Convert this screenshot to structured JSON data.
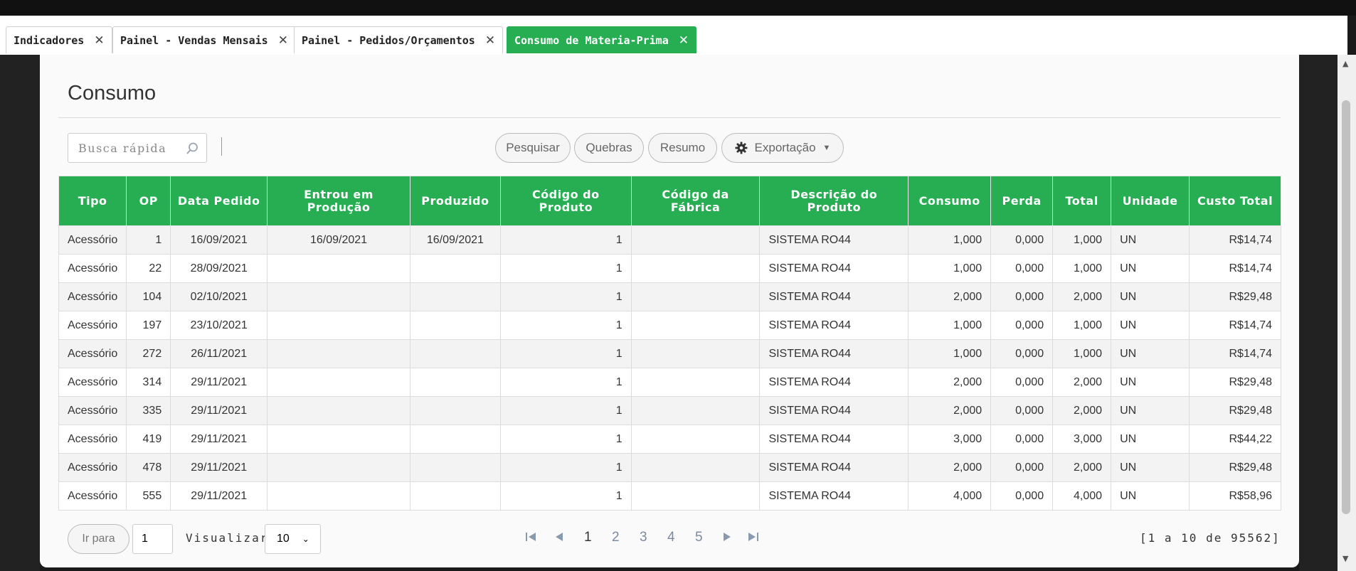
{
  "tabs": [
    {
      "label": "Indicadores",
      "active": false
    },
    {
      "label": "Painel - Vendas Mensais",
      "active": false
    },
    {
      "label": "Painel - Pedidos/Orçamentos",
      "active": false
    },
    {
      "label": "Consumo de Materia-Prima",
      "active": true
    }
  ],
  "page": {
    "title": "Consumo"
  },
  "search": {
    "placeholder": "Busca rápida"
  },
  "toolbar": {
    "pesquisar": "Pesquisar",
    "quebras": "Quebras",
    "resumo": "Resumo",
    "exportacao": "Exportação"
  },
  "table": {
    "headers": {
      "tipo": "Tipo",
      "op": "OP",
      "data_pedido": "Data Pedido",
      "entrou": "Entrou em Produção",
      "produzido": "Produzido",
      "cod_produto": "Código do Produto",
      "cod_fabrica": "Código da Fábrica",
      "descricao": "Descrição do Produto",
      "consumo": "Consumo",
      "perda": "Perda",
      "total": "Total",
      "unidade": "Unidade",
      "custo": "Custo Total"
    },
    "rows": [
      {
        "tipo": "Acessório",
        "op": "1",
        "data": "16/09/2021",
        "entrou": "16/09/2021",
        "produzido": "16/09/2021",
        "cod_produto": "1",
        "cod_fabrica": "",
        "descricao": "SISTEMA RO44",
        "consumo": "1,000",
        "perda": "0,000",
        "total": "1,000",
        "unidade": "UN",
        "custo": "R$14,74"
      },
      {
        "tipo": "Acessório",
        "op": "22",
        "data": "28/09/2021",
        "entrou": "",
        "produzido": "",
        "cod_produto": "1",
        "cod_fabrica": "",
        "descricao": "SISTEMA RO44",
        "consumo": "1,000",
        "perda": "0,000",
        "total": "1,000",
        "unidade": "UN",
        "custo": "R$14,74"
      },
      {
        "tipo": "Acessório",
        "op": "104",
        "data": "02/10/2021",
        "entrou": "",
        "produzido": "",
        "cod_produto": "1",
        "cod_fabrica": "",
        "descricao": "SISTEMA RO44",
        "consumo": "2,000",
        "perda": "0,000",
        "total": "2,000",
        "unidade": "UN",
        "custo": "R$29,48"
      },
      {
        "tipo": "Acessório",
        "op": "197",
        "data": "23/10/2021",
        "entrou": "",
        "produzido": "",
        "cod_produto": "1",
        "cod_fabrica": "",
        "descricao": "SISTEMA RO44",
        "consumo": "1,000",
        "perda": "0,000",
        "total": "1,000",
        "unidade": "UN",
        "custo": "R$14,74"
      },
      {
        "tipo": "Acessório",
        "op": "272",
        "data": "26/11/2021",
        "entrou": "",
        "produzido": "",
        "cod_produto": "1",
        "cod_fabrica": "",
        "descricao": "SISTEMA RO44",
        "consumo": "1,000",
        "perda": "0,000",
        "total": "1,000",
        "unidade": "UN",
        "custo": "R$14,74"
      },
      {
        "tipo": "Acessório",
        "op": "314",
        "data": "29/11/2021",
        "entrou": "",
        "produzido": "",
        "cod_produto": "1",
        "cod_fabrica": "",
        "descricao": "SISTEMA RO44",
        "consumo": "2,000",
        "perda": "0,000",
        "total": "2,000",
        "unidade": "UN",
        "custo": "R$29,48"
      },
      {
        "tipo": "Acessório",
        "op": "335",
        "data": "29/11/2021",
        "entrou": "",
        "produzido": "",
        "cod_produto": "1",
        "cod_fabrica": "",
        "descricao": "SISTEMA RO44",
        "consumo": "2,000",
        "perda": "0,000",
        "total": "2,000",
        "unidade": "UN",
        "custo": "R$29,48"
      },
      {
        "tipo": "Acessório",
        "op": "419",
        "data": "29/11/2021",
        "entrou": "",
        "produzido": "",
        "cod_produto": "1",
        "cod_fabrica": "",
        "descricao": "SISTEMA RO44",
        "consumo": "3,000",
        "perda": "0,000",
        "total": "3,000",
        "unidade": "UN",
        "custo": "R$44,22"
      },
      {
        "tipo": "Acessório",
        "op": "478",
        "data": "29/11/2021",
        "entrou": "",
        "produzido": "",
        "cod_produto": "1",
        "cod_fabrica": "",
        "descricao": "SISTEMA RO44",
        "consumo": "2,000",
        "perda": "0,000",
        "total": "2,000",
        "unidade": "UN",
        "custo": "R$29,48"
      },
      {
        "tipo": "Acessório",
        "op": "555",
        "data": "29/11/2021",
        "entrou": "",
        "produzido": "",
        "cod_produto": "1",
        "cod_fabrica": "",
        "descricao": "SISTEMA RO44",
        "consumo": "4,000",
        "perda": "0,000",
        "total": "4,000",
        "unidade": "UN",
        "custo": "R$58,96"
      }
    ]
  },
  "pager": {
    "goto_label": "Ir para",
    "goto_value": "1",
    "visualizar_label": "Visualizar",
    "page_size": "10",
    "pages": [
      "1",
      "2",
      "3",
      "4",
      "5"
    ],
    "current_page": "1",
    "count_text": "[1 a 10 de 95562]"
  },
  "colors": {
    "accent": "#27ae53"
  }
}
